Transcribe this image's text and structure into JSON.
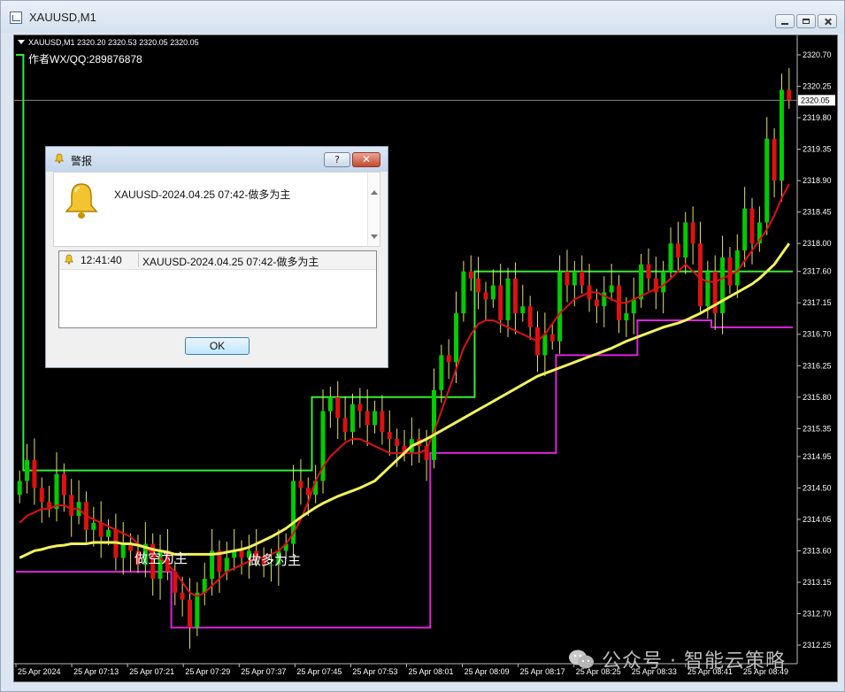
{
  "window": {
    "title": "XAUUSD,M1"
  },
  "chart_info": {
    "header": "XAUUSD,M1  2320.20 2320.53 2320.05 2320.05",
    "author": "作者WX/QQ:289876878",
    "label_short": "做空为主",
    "label_long": "做多为主"
  },
  "colors": {
    "background": "#000000",
    "candle_up": "#00cc00",
    "candle_down": "#dd1111",
    "wick": "#e6e070",
    "ma_fast": "#dd1111",
    "ma_slow": "#f2f25a",
    "upper_step": "#33ee33",
    "lower_step": "#dd22dd",
    "bid_line": "#9a9a9a"
  },
  "chart_data": {
    "type": "candlestick",
    "symbol": "XAUUSD",
    "timeframe": "M1",
    "y_ticks": [
      "2320.70",
      "2320.25",
      "2319.80",
      "2319.35",
      "2318.90",
      "2318.45",
      "2318.00",
      "2317.60",
      "2317.15",
      "2316.70",
      "2316.25",
      "2315.80",
      "2315.35",
      "2314.95",
      "2314.50",
      "2314.05",
      "2313.60",
      "2313.15",
      "2312.70",
      "2312.25"
    ],
    "y_range": [
      2312.25,
      2320.7
    ],
    "current_price": "2320.05",
    "x_ticks": [
      "25 Apr 2024",
      "25 Apr 07:13",
      "25 Apr 07:21",
      "25 Apr 07:29",
      "25 Apr 07:37",
      "25 Apr 07:45",
      "25 Apr 07:53",
      "25 Apr 08:01",
      "25 Apr 08:09",
      "25 Apr 08:17",
      "25 Apr 08:25",
      "25 Apr 08:33",
      "25 Apr 08:41",
      "25 Apr 08:49"
    ],
    "closes": [
      2314.6,
      2314.9,
      2314.5,
      2314.3,
      2314.2,
      2314.7,
      2314.4,
      2314.1,
      2314.3,
      2313.9,
      2314.0,
      2313.8,
      2313.9,
      2313.5,
      2313.7,
      2313.6,
      2313.4,
      2313.7,
      2313.2,
      2313.6,
      2313.3,
      2313.0,
      2312.9,
      2312.5,
      2313.0,
      2313.2,
      2313.6,
      2313.3,
      2313.5,
      2313.6,
      2313.5,
      2313.6,
      2313.5,
      2313.4,
      2313.4,
      2313.6,
      2313.7,
      2314.6,
      2314.5,
      2314.4,
      2314.6,
      2315.6,
      2315.8,
      2315.5,
      2315.3,
      2315.7,
      2315.6,
      2315.4,
      2315.6,
      2315.3,
      2315.2,
      2315.1,
      2315.0,
      2315.2,
      2315.1,
      2314.9,
      2315.9,
      2316.4,
      2316.3,
      2317.0,
      2317.6,
      2317.5,
      2317.3,
      2317.2,
      2317.4,
      2316.9,
      2317.5,
      2317.0,
      2317.1,
      2316.8,
      2316.4,
      2316.7,
      2316.6,
      2317.6,
      2317.4,
      2317.6,
      2317.4,
      2317.2,
      2317.1,
      2317.3,
      2317.4,
      2316.9,
      2317.0,
      2317.2,
      2317.7,
      2317.5,
      2317.3,
      2317.6,
      2318.0,
      2317.8,
      2318.3,
      2318.0,
      2317.1,
      2317.6,
      2317.0,
      2317.8,
      2317.4,
      2317.9,
      2318.5,
      2318.0,
      2318.3,
      2319.5,
      2318.9,
      2320.2,
      2320.05
    ],
    "series": [
      {
        "name": "fast MA",
        "values": [
          2314.0,
          2314.1,
          2314.15,
          2314.2,
          2314.2,
          2314.25,
          2314.25,
          2314.2,
          2314.2,
          2314.1,
          2314.05,
          2314.0,
          2313.95,
          2313.9,
          2313.85,
          2313.8,
          2313.7,
          2313.65,
          2313.55,
          2313.5,
          2313.4,
          2313.3,
          2313.15,
          2313.0,
          2312.95,
          2313.0,
          2313.1,
          2313.2,
          2313.3,
          2313.35,
          2313.4,
          2313.45,
          2313.5,
          2313.5,
          2313.55,
          2313.6,
          2313.7,
          2313.85,
          2314.05,
          2314.3,
          2314.6,
          2314.8,
          2314.95,
          2315.05,
          2315.15,
          2315.2,
          2315.2,
          2315.15,
          2315.1,
          2315.05,
          2315.0,
          2315.0,
          2315.0,
          2315.0,
          2315.0,
          2315.05,
          2315.3,
          2315.6,
          2315.9,
          2316.2,
          2316.5,
          2316.7,
          2316.85,
          2316.9,
          2316.9,
          2316.85,
          2316.8,
          2316.75,
          2316.7,
          2316.65,
          2316.6,
          2316.7,
          2316.85,
          2317.0,
          2317.1,
          2317.2,
          2317.25,
          2317.3,
          2317.3,
          2317.25,
          2317.2,
          2317.15,
          2317.15,
          2317.2,
          2317.25,
          2317.3,
          2317.35,
          2317.4,
          2317.5,
          2317.6,
          2317.7,
          2317.6,
          2317.5,
          2317.45,
          2317.45,
          2317.5,
          2317.55,
          2317.6,
          2317.75,
          2317.9,
          2318.05,
          2318.2,
          2318.4,
          2318.65,
          2318.85
        ]
      },
      {
        "name": "slow MA",
        "values": [
          2313.5,
          2313.55,
          2313.6,
          2313.62,
          2313.65,
          2313.67,
          2313.68,
          2313.7,
          2313.7,
          2313.7,
          2313.72,
          2313.72,
          2313.72,
          2313.72,
          2313.7,
          2313.7,
          2313.68,
          2313.65,
          2313.62,
          2313.6,
          2313.58,
          2313.55,
          2313.55,
          2313.55,
          2313.55,
          2313.55,
          2313.55,
          2313.56,
          2313.58,
          2313.6,
          2313.62,
          2313.65,
          2313.7,
          2313.75,
          2313.8,
          2313.86,
          2313.92,
          2314.0,
          2314.08,
          2314.15,
          2314.22,
          2314.28,
          2314.33,
          2314.38,
          2314.42,
          2314.46,
          2314.5,
          2314.55,
          2314.6,
          2314.7,
          2314.8,
          2314.9,
          2315.0,
          2315.1,
          2315.15,
          2315.2,
          2315.26,
          2315.32,
          2315.38,
          2315.44,
          2315.5,
          2315.56,
          2315.62,
          2315.68,
          2315.74,
          2315.8,
          2315.86,
          2315.92,
          2315.98,
          2316.04,
          2316.1,
          2316.14,
          2316.18,
          2316.22,
          2316.26,
          2316.3,
          2316.34,
          2316.38,
          2316.42,
          2316.46,
          2316.5,
          2316.55,
          2316.6,
          2316.64,
          2316.68,
          2316.72,
          2316.76,
          2316.8,
          2316.83,
          2316.86,
          2316.9,
          2316.95,
          2317.0,
          2317.06,
          2317.12,
          2317.18,
          2317.24,
          2317.3,
          2317.36,
          2317.42,
          2317.5,
          2317.6,
          2317.7,
          2317.85,
          2318.0
        ]
      }
    ]
  },
  "alert_dialog": {
    "title": "警报",
    "help": "?",
    "message": "XAUUSD-2024.04.25 07:42-做多为主",
    "list_time": "12:41:40",
    "list_message": "XAUUSD-2024.04.25 07:42-做多为主",
    "ok": "OK"
  },
  "watermark": {
    "text": "公众号 · 智能云策略"
  }
}
